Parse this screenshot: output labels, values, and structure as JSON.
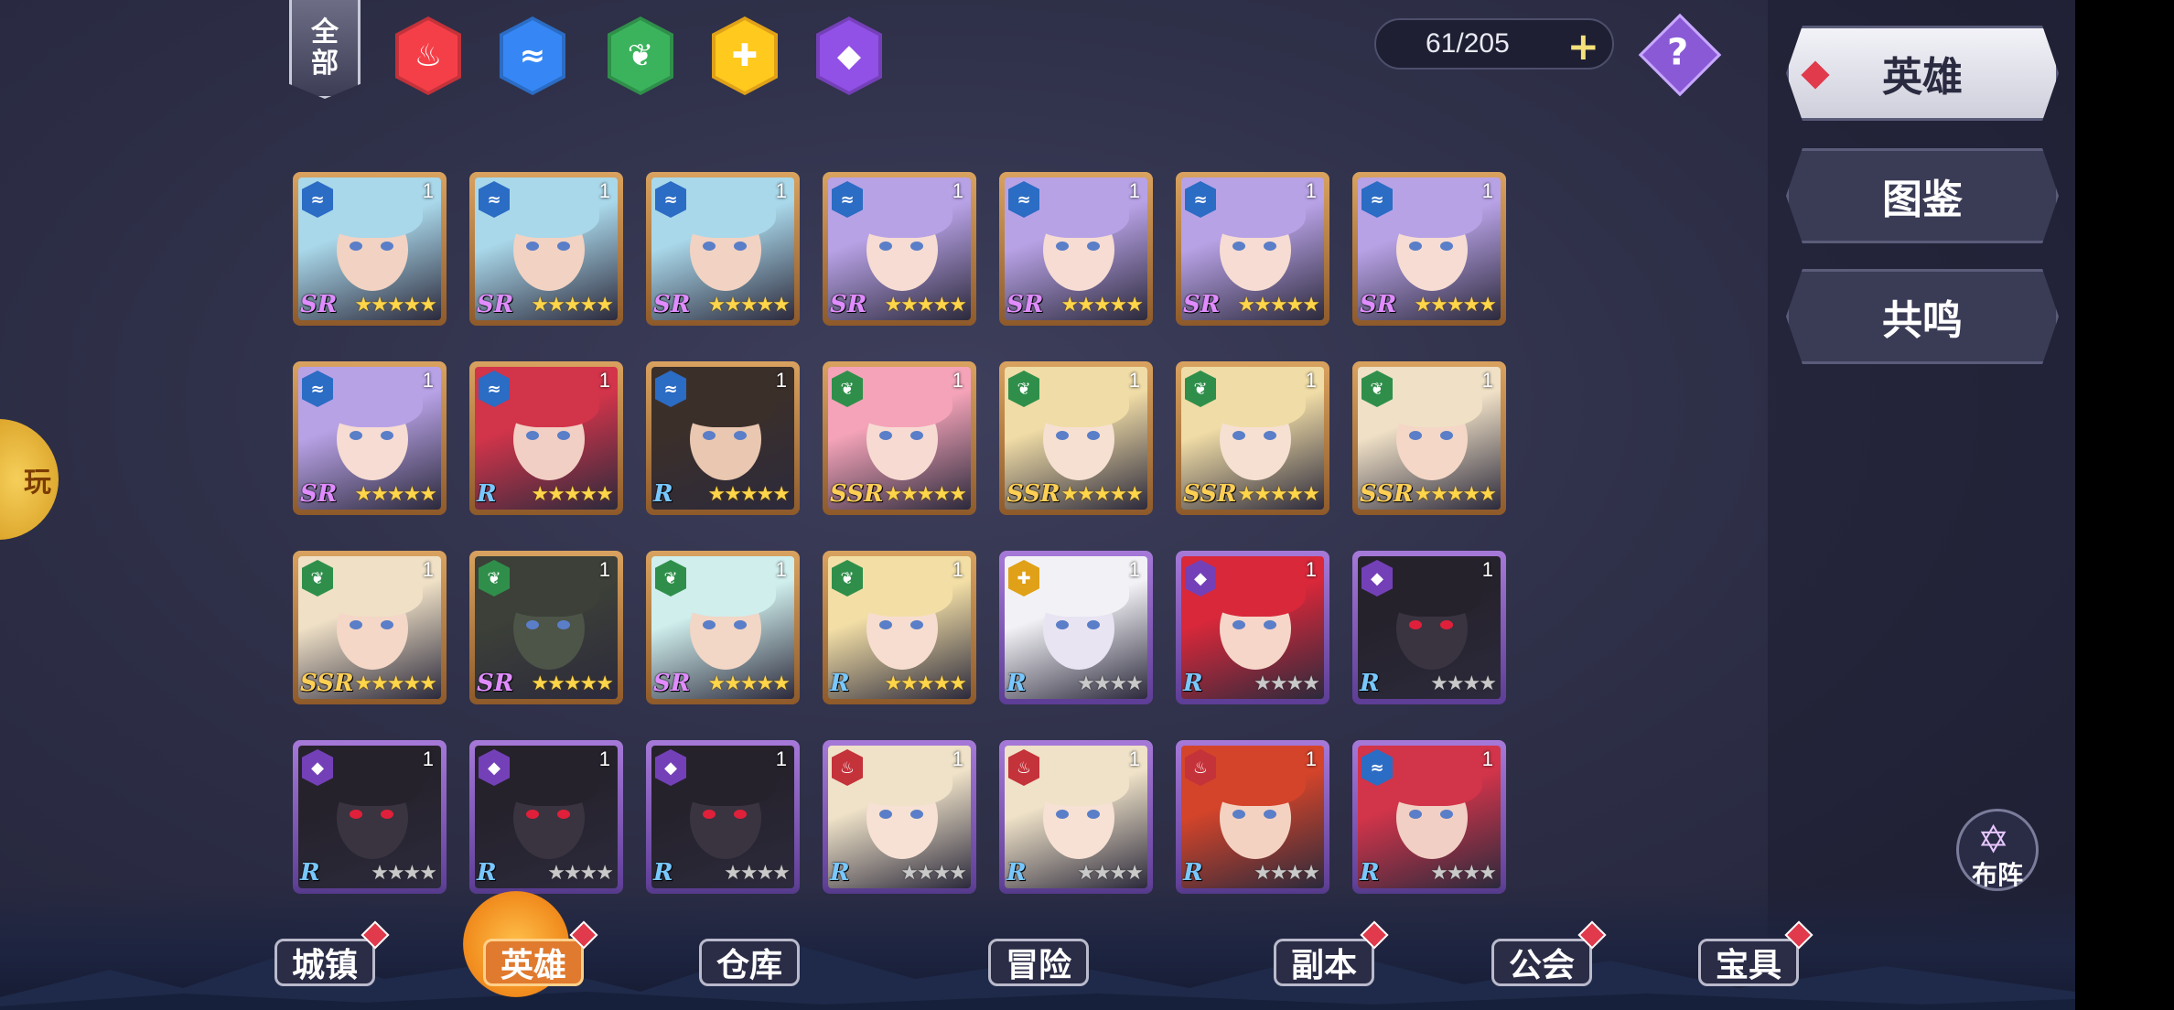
{
  "filters": {
    "all_label": "全部",
    "elements": [
      {
        "name": "fire",
        "color": "#c4323a"
      },
      {
        "name": "water",
        "color": "#2b6cc4"
      },
      {
        "name": "wind",
        "color": "#2f8f4a"
      },
      {
        "name": "light",
        "color": "#e0a118"
      },
      {
        "name": "dark",
        "color": "#7440b8"
      }
    ]
  },
  "hero_count": "61/205",
  "side_tabs": [
    "英雄",
    "图鉴",
    "共鸣"
  ],
  "formation_label": "布阵",
  "side_widget_label": "玩",
  "bottom_nav": [
    "城镇",
    "英雄",
    "仓库",
    "冒险",
    "副本",
    "公会",
    "宝具"
  ],
  "heroes": [
    {
      "rarity": "SR",
      "element": "water",
      "level": "1",
      "stars": "★★★★★",
      "frame": "gold",
      "hair": "#a9d8ea",
      "skin": "#f2d2c2"
    },
    {
      "rarity": "SR",
      "element": "water",
      "level": "1",
      "stars": "★★★★★",
      "frame": "gold",
      "hair": "#a9d8ea",
      "skin": "#f2d2c2"
    },
    {
      "rarity": "SR",
      "element": "water",
      "level": "1",
      "stars": "★★★★★",
      "frame": "gold",
      "hair": "#a9d8ea",
      "skin": "#f2d2c2"
    },
    {
      "rarity": "SR",
      "element": "water",
      "level": "1",
      "stars": "★★★★★",
      "frame": "gold",
      "hair": "#b8a2e6",
      "skin": "#f6dcd2"
    },
    {
      "rarity": "SR",
      "element": "water",
      "level": "1",
      "stars": "★★★★★",
      "frame": "gold",
      "hair": "#b8a2e6",
      "skin": "#f6dcd2"
    },
    {
      "rarity": "SR",
      "element": "water",
      "level": "1",
      "stars": "★★★★★",
      "frame": "gold",
      "hair": "#b8a2e6",
      "skin": "#f6dcd2"
    },
    {
      "rarity": "SR",
      "element": "water",
      "level": "1",
      "stars": "★★★★★",
      "frame": "gold",
      "hair": "#b8a2e6",
      "skin": "#f6dcd2"
    },
    {
      "rarity": "SR",
      "element": "water",
      "level": "1",
      "stars": "★★★★★",
      "frame": "gold",
      "hair": "#b8a2e6",
      "skin": "#f6dcd2"
    },
    {
      "rarity": "R",
      "element": "water",
      "level": "1",
      "stars": "★★★★★",
      "frame": "gold",
      "hair": "#d2344a",
      "skin": "#f2cfc4"
    },
    {
      "rarity": "R",
      "element": "water",
      "level": "1",
      "stars": "★★★★★",
      "frame": "gold",
      "hair": "#3b2f2a",
      "skin": "#e9c7b0"
    },
    {
      "rarity": "SSR",
      "element": "wind",
      "level": "1",
      "stars": "★★★★★",
      "frame": "gold",
      "hair": "#f4a3b8",
      "skin": "#f7dbd2"
    },
    {
      "rarity": "SSR",
      "element": "wind",
      "level": "1",
      "stars": "★★★★★",
      "frame": "gold",
      "hair": "#f0dca6",
      "skin": "#f6e0d2"
    },
    {
      "rarity": "SSR",
      "element": "wind",
      "level": "1",
      "stars": "★★★★★",
      "frame": "gold",
      "hair": "#f0dca6",
      "skin": "#f6e0d2"
    },
    {
      "rarity": "SSR",
      "element": "wind",
      "level": "1",
      "stars": "★★★★★",
      "frame": "gold",
      "hair": "#efe0c6",
      "skin": "#f4d7c6"
    },
    {
      "rarity": "SSR",
      "element": "wind",
      "level": "1",
      "stars": "★★★★★",
      "frame": "gold",
      "hair": "#efe0c6",
      "skin": "#f4d7c6"
    },
    {
      "rarity": "SR",
      "element": "wind",
      "level": "1",
      "stars": "★★★★★",
      "frame": "gold",
      "hair": "#3c4038",
      "skin": "#4d5448"
    },
    {
      "rarity": "SR",
      "element": "wind",
      "level": "1",
      "stars": "★★★★★",
      "frame": "gold",
      "hair": "#cfeeec",
      "skin": "#f2d6c6"
    },
    {
      "rarity": "R",
      "element": "wind",
      "level": "1",
      "stars": "★★★★★",
      "frame": "gold",
      "hair": "#f3dfa6",
      "skin": "#f7ddd0"
    },
    {
      "rarity": "R",
      "element": "light",
      "level": "1",
      "stars": "★★★★",
      "frame": "purple",
      "hair": "#f2f2f6",
      "skin": "#e9e4f2"
    },
    {
      "rarity": "R",
      "element": "dark",
      "level": "1",
      "stars": "★★★★",
      "frame": "purple",
      "hair": "#d8283a",
      "skin": "#f6d6c8"
    },
    {
      "rarity": "R",
      "element": "dark",
      "level": "1",
      "stars": "★★★★",
      "frame": "purple",
      "hair": "#26222c",
      "skin": "#3a3440"
    },
    {
      "rarity": "R",
      "element": "dark",
      "level": "1",
      "stars": "★★★★",
      "frame": "purple",
      "hair": "#26222c",
      "skin": "#3a3440"
    },
    {
      "rarity": "R",
      "element": "dark",
      "level": "1",
      "stars": "★★★★",
      "frame": "purple",
      "hair": "#26222c",
      "skin": "#3a3440"
    },
    {
      "rarity": "R",
      "element": "dark",
      "level": "1",
      "stars": "★★★★",
      "frame": "purple",
      "hair": "#26222c",
      "skin": "#3a3440"
    },
    {
      "rarity": "R",
      "element": "fire",
      "level": "1",
      "stars": "★★★★",
      "frame": "purple",
      "hair": "#efe2c8",
      "skin": "#f7e1d4"
    },
    {
      "rarity": "R",
      "element": "fire",
      "level": "1",
      "stars": "★★★★",
      "frame": "purple",
      "hair": "#efe2c8",
      "skin": "#f7e1d4"
    },
    {
      "rarity": "R",
      "element": "fire",
      "level": "1",
      "stars": "★★★★",
      "frame": "purple",
      "hair": "#d4442a",
      "skin": "#f4d2c2"
    },
    {
      "rarity": "R",
      "element": "water",
      "level": "1",
      "stars": "★★★★",
      "frame": "purple",
      "hair": "#d2344a",
      "skin": "#f2cfc4"
    }
  ],
  "rarity_colors": {
    "SSR": "#ffcf54",
    "SR": "#e08cff",
    "R": "#78c8ff"
  }
}
